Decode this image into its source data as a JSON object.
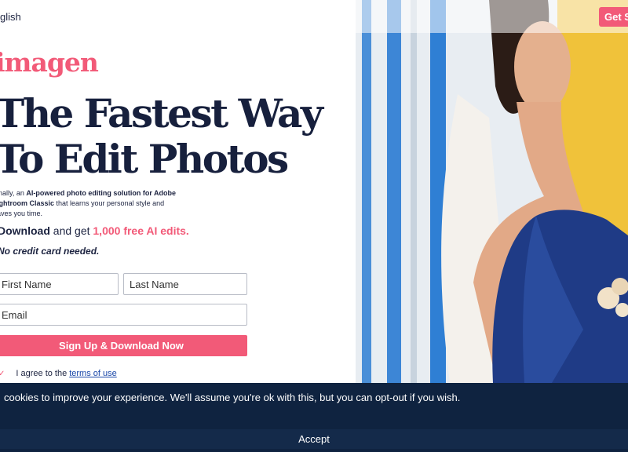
{
  "header": {
    "language": "glish",
    "cta_label": "Get S"
  },
  "brand": {
    "logo_text": "imagen"
  },
  "hero": {
    "headline_line1": "The Fastest Way",
    "headline_line2": "To Edit Photos",
    "desc_pre": "inally, an ",
    "desc_bold1": "AI-powered photo editing solution for Adobe",
    "desc_bold2": "ightroom Classic",
    "desc_post1": " that learns your personal style and",
    "desc_post2": "aves you time.",
    "offer_pre": "Download",
    "offer_mid": " and get ",
    "offer_highlight": "1,000 free AI edits.",
    "no_card": "No credit card needed."
  },
  "form": {
    "first_name_placeholder": "First Name",
    "last_name_placeholder": "Last Name",
    "email_placeholder": "Email",
    "submit_label": "Sign Up & Download Now",
    "agree_check": "✓",
    "agree_text": "I agree to the",
    "terms_link": "terms of use"
  },
  "cookie_banner": {
    "message": "cookies to improve your experience. We'll assume you're ok with this, but you can opt-out if you wish.",
    "accept_label": "Accept"
  },
  "colors": {
    "brand_pink": "#f25a78",
    "navy": "#17203d",
    "banner_bg": "#0f2340"
  }
}
